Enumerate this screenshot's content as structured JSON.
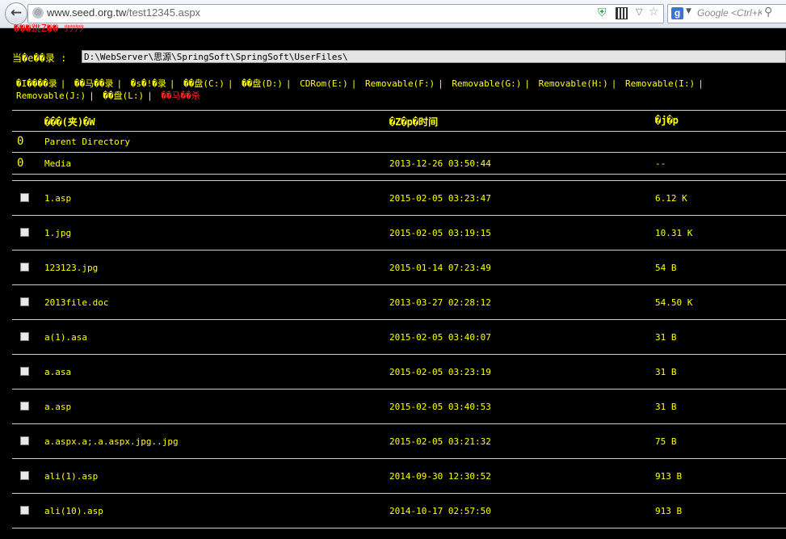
{
  "browser": {
    "back_glyph": "←",
    "globe_glyph": "◎",
    "url_host": "www.seed.org.tw",
    "url_path": "/test12345.aspx",
    "search_engine_glyph": "g",
    "search_placeholder": "Google <Ctrl+K>",
    "icons": [
      "back-icon",
      "globe-icon",
      "shield-icon",
      "qr-code-icon",
      "dropdown-icon",
      "bookmark-star-icon",
      "google-icon",
      "search-icon"
    ]
  },
  "page": {
    "title_fragment": "���跳Z�� ﾂﾂﾂﾂ",
    "current_path_label": "当�e��录 :",
    "current_path_value": "D:\\WebServer\\思源\\SpringSoft\\SpringSoft\\UserFiles\\",
    "nav": [
      {
        "label": "�I����录",
        "red": false
      },
      {
        "label": "��马��录",
        "red": false
      },
      {
        "label": "�s�!�录",
        "red": false
      },
      {
        "label": "��盘(C:)",
        "red": false
      },
      {
        "label": "��盘(D:)",
        "red": false
      },
      {
        "label": "CDRom(E:)",
        "red": false
      },
      {
        "label": "Removable(F:)",
        "red": false
      },
      {
        "label": "Removable(G:)",
        "red": false
      },
      {
        "label": "Removable(H:)",
        "red": false
      },
      {
        "label": "Removable(I:)",
        "red": false
      },
      {
        "label": "Removable(J:)",
        "red": false
      },
      {
        "label": "��盘(L:)",
        "red": false
      },
      {
        "label": "��马��杀",
        "red": true
      }
    ],
    "nav_separator": "|",
    "table": {
      "headers": {
        "name": "���(夹)�W",
        "time": "�Z�p�时间",
        "size": "�j�p"
      },
      "dir_icon": "0",
      "dirs": [
        {
          "name": "Parent Directory",
          "time": "",
          "size": ""
        },
        {
          "name": "Media",
          "time": "2013-12-26 03:50:44",
          "size": "--"
        }
      ],
      "files": [
        {
          "name": "1.asp",
          "time": "2015-02-05 03:23:47",
          "size": "6.12 K"
        },
        {
          "name": "1.jpg",
          "time": "2015-02-05 03:19:15",
          "size": "10.31 K"
        },
        {
          "name": "123123.jpg",
          "time": "2015-01-14 07:23:49",
          "size": "54 B"
        },
        {
          "name": "2013file.doc",
          "time": "2013-03-27 02:28:12",
          "size": "54.50 K"
        },
        {
          "name": "a(1).asa",
          "time": "2015-02-05 03:40:07",
          "size": "31 B"
        },
        {
          "name": "a.asa",
          "time": "2015-02-05 03:23:19",
          "size": "31 B"
        },
        {
          "name": "a.asp",
          "time": "2015-02-05 03:40:53",
          "size": "31 B"
        },
        {
          "name": "a.aspx.a;.a.aspx.jpg..jpg",
          "time": "2015-02-05 03:21:32",
          "size": "75 B"
        },
        {
          "name": "ali(1).asp",
          "time": "2014-09-30 12:30:52",
          "size": "913 B"
        },
        {
          "name": "ali(10).asp",
          "time": "2014-10-17 02:57:50",
          "size": "913 B"
        }
      ]
    }
  }
}
